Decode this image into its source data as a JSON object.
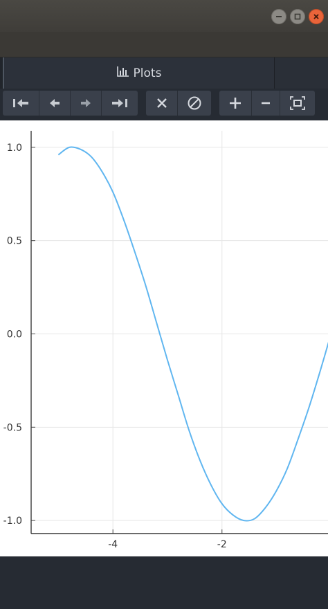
{
  "window": {
    "minimize_icon": "minimize-icon",
    "maximize_icon": "maximize-icon",
    "close_icon": "close-icon"
  },
  "tab": {
    "label": "Plots",
    "icon": "bar-chart-icon"
  },
  "toolbar": {
    "buttons": [
      "first-plot",
      "previous-plot",
      "next-plot",
      "last-plot",
      "delete-plot",
      "clear-plots",
      "zoom-in",
      "zoom-out",
      "fit-to-window"
    ]
  },
  "colors": {
    "series": "#60b6f0",
    "accent_close": "#e9643a"
  },
  "chart_data": {
    "type": "line",
    "title": "",
    "xlabel": "",
    "ylabel": "",
    "xlim": [
      -5.5,
      0.3
    ],
    "ylim": [
      -1.07,
      1.07
    ],
    "xticks": [
      "-4",
      "-2"
    ],
    "xtick_values": [
      -4,
      -2
    ],
    "yticks": [
      "1.0",
      "0.5",
      "0.0",
      "-0.5",
      "-1.0"
    ],
    "ytick_values": [
      1.0,
      0.5,
      0.0,
      -0.5,
      -1.0
    ],
    "grid": true,
    "series": [
      {
        "x": [
          -5.0,
          -4.8,
          -4.6,
          -4.4,
          -4.2,
          -4.0,
          -3.8,
          -3.6,
          -3.4,
          -3.2,
          -3.0,
          -2.8,
          -2.6,
          -2.4,
          -2.2,
          -2.0,
          -1.8,
          -1.6,
          -1.4,
          -1.2,
          -1.0,
          -0.8,
          -0.6,
          -0.4,
          -0.2,
          0.0
        ],
        "y": [
          0.96,
          1.0,
          0.99,
          0.95,
          0.87,
          0.76,
          0.61,
          0.44,
          0.26,
          0.06,
          -0.14,
          -0.33,
          -0.52,
          -0.68,
          -0.81,
          -0.91,
          -0.97,
          -1.0,
          -0.99,
          -0.93,
          -0.84,
          -0.72,
          -0.56,
          -0.39,
          -0.2,
          0.0
        ]
      }
    ]
  }
}
